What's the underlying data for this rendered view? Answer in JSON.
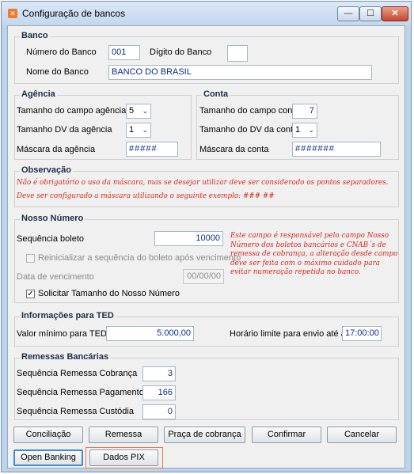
{
  "window": {
    "title": "Configuração de bancos",
    "controls": {
      "min": "—",
      "max": "☐",
      "close": "✕"
    }
  },
  "banco": {
    "title": "Banco",
    "numero_label": "Número do Banco",
    "numero_value": "001",
    "digito_label": "Dígito do Banco",
    "digito_value": "",
    "nome_label": "Nome do Banco",
    "nome_value": "BANCO DO BRASIL"
  },
  "agencia": {
    "title": "Agência",
    "tamanho_label": "Tamanho do campo agência",
    "tamanho_value": "5",
    "dv_label": "Tamanho DV da agência",
    "dv_value": "1",
    "mascara_label": "Máscara da agência",
    "mascara_value": "#####"
  },
  "conta": {
    "title": "Conta",
    "tamanho_label": "Tamanho do campo conta",
    "tamanho_value": "7",
    "dv_label": "Tamanho do DV da conta",
    "dv_value": "1",
    "mascara_label": "Máscara da conta",
    "mascara_value": "#######"
  },
  "observacao": {
    "title": "Observação",
    "line1": "Não é obrigatório o uso da máscara, mas se desejar utilizar deve ser considerado os pontos separadores.",
    "line2": "Deve ser configurado a máscara utilizando o seguinte exemplo: ### ##"
  },
  "nosso_numero": {
    "title": "Nosso Número",
    "sequencia_label": "Sequência boleto",
    "sequencia_value": "10000",
    "reinicializar_label": "Reinicializar a sequência do boleto após vencimento",
    "data_label": "Data de vencimento",
    "data_value": "00/00/00",
    "solicitar_label": "Solicitar Tamanho do Nosso Número",
    "solicitar_checked": "✓",
    "note_lines": [
      "Este campo é responsável pelo campo Nosso",
      "Número dos boletos bancários e CNAB´s de",
      "remessa de cobrança, a alteração desde campo",
      "deve ser feita com o máximo cuidado para",
      "evitar numeração repetida no banco."
    ]
  },
  "ted": {
    "title": "Informações para TED",
    "valor_label": "Valor mínimo para TED",
    "valor_value": "5.000,00",
    "horario_label": "Horário limite para envio até às",
    "horario_value": "17:00:00"
  },
  "remessas": {
    "title": "Remessas Bancárias",
    "cobranca_label": "Sequência Remessa Cobrança",
    "cobranca_value": "3",
    "pagamento_label": "Sequência Remessa Pagamento",
    "pagamento_value": "166",
    "custodia_label": "Sequência Remessa Custódia",
    "custodia_value": "0"
  },
  "buttons": {
    "conciliacao": "Conciliação",
    "remessa": "Remessa",
    "praca": "Praça de cobrança",
    "confirmar": "Confirmar",
    "cancelar": "Cancelar",
    "open_banking": "Open Banking",
    "dados_pix": "Dados PIX"
  },
  "colors": {
    "accent": "#3a8fd6",
    "note_red": "#d8261e",
    "highlight": "#f0784a"
  }
}
